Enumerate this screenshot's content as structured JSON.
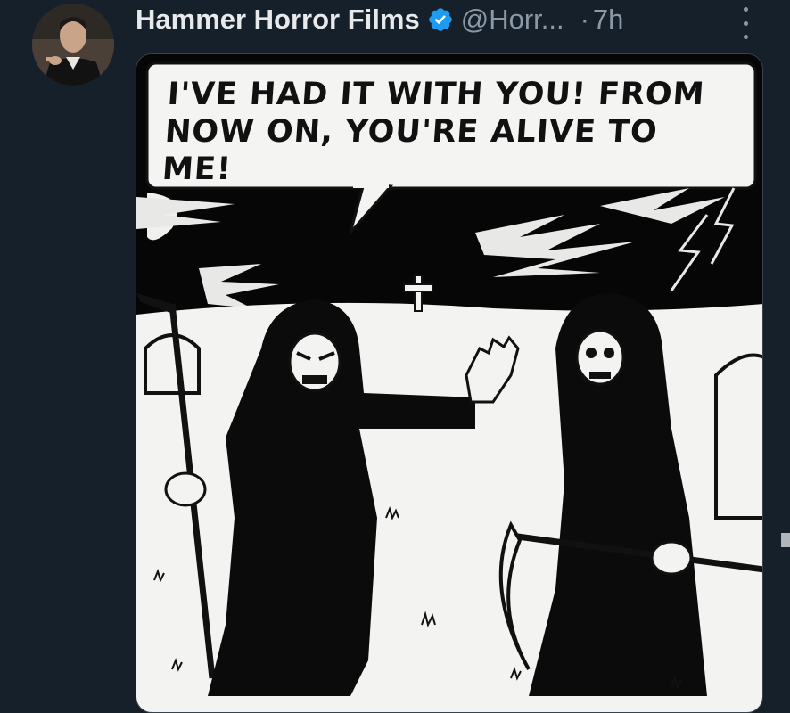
{
  "tweet": {
    "author_name": "Hammer Horror Films",
    "handle": "@Horr...",
    "separator": "·",
    "time": "7h"
  },
  "icons": {
    "verified": "verified-badge-icon",
    "more": "more-options-icon"
  },
  "colors": {
    "background": "#15202b",
    "name": "#e7e9ea",
    "secondary": "#8b98a5",
    "verified": "#1d9bf0"
  },
  "media": {
    "caption_line1": "I'VE HAD IT WITH YOU! FROM",
    "caption_line2": "NOW ON, YOU'RE ALIVE TO ME!"
  }
}
